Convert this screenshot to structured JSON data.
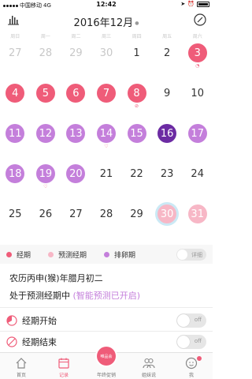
{
  "status_bar": {
    "carrier": "中国移动",
    "network": "4G",
    "time": "12:42"
  },
  "header": {
    "title": "2016年12月"
  },
  "weekdays": [
    "周日",
    "周一",
    "周二",
    "周三",
    "周四",
    "周五",
    "周六"
  ],
  "calendar": {
    "weeks": [
      [
        {
          "day": "27",
          "state": "prev"
        },
        {
          "day": "28",
          "state": "prev"
        },
        {
          "day": "29",
          "state": "prev"
        },
        {
          "day": "30",
          "state": "prev"
        },
        {
          "day": "1",
          "state": "normal"
        },
        {
          "day": "2",
          "state": "normal"
        },
        {
          "day": "3",
          "state": "period",
          "mark": "period-start"
        }
      ],
      [
        {
          "day": "4",
          "state": "period"
        },
        {
          "day": "5",
          "state": "period"
        },
        {
          "day": "6",
          "state": "period"
        },
        {
          "day": "7",
          "state": "period"
        },
        {
          "day": "8",
          "state": "period",
          "mark": "period-end"
        },
        {
          "day": "9",
          "state": "normal"
        },
        {
          "day": "10",
          "state": "normal"
        }
      ],
      [
        {
          "day": "11",
          "state": "ovulation"
        },
        {
          "day": "12",
          "state": "ovulation"
        },
        {
          "day": "13",
          "state": "ovulation"
        },
        {
          "day": "14",
          "state": "ovulation",
          "mark": "heart"
        },
        {
          "day": "15",
          "state": "ovulation"
        },
        {
          "day": "16",
          "state": "ovulation-day"
        },
        {
          "day": "17",
          "state": "ovulation"
        }
      ],
      [
        {
          "day": "18",
          "state": "ovulation"
        },
        {
          "day": "19",
          "state": "ovulation",
          "mark": "heart"
        },
        {
          "day": "20",
          "state": "ovulation"
        },
        {
          "day": "21",
          "state": "normal"
        },
        {
          "day": "22",
          "state": "normal"
        },
        {
          "day": "23",
          "state": "normal"
        },
        {
          "day": "24",
          "state": "normal"
        }
      ],
      [
        {
          "day": "25",
          "state": "normal"
        },
        {
          "day": "26",
          "state": "normal"
        },
        {
          "day": "27",
          "state": "normal"
        },
        {
          "day": "28",
          "state": "normal"
        },
        {
          "day": "29",
          "state": "normal"
        },
        {
          "day": "30",
          "state": "today-predicted"
        },
        {
          "day": "31",
          "state": "predicted"
        }
      ]
    ]
  },
  "legend": {
    "items": [
      {
        "label": "经期",
        "color": "#ef5c79"
      },
      {
        "label": "预测经期",
        "color": "#f7b7c6"
      },
      {
        "label": "排卵期",
        "color": "#c47fdb"
      }
    ],
    "detail_toggle": "详细"
  },
  "info": {
    "lunar_date": "农历丙申(猴)年腊月初二",
    "phase_text": "处于预测经期中",
    "phase_note": "(智能预测已开启)"
  },
  "settings": [
    {
      "label": "经期开始",
      "state": "off"
    },
    {
      "label": "经期结束",
      "state": "off"
    }
  ],
  "tabbar": {
    "tabs": [
      {
        "label": "首页",
        "icon": "home-icon",
        "active": false
      },
      {
        "label": "记录",
        "icon": "calendar-icon",
        "active": true
      },
      {
        "label": "年终促销",
        "icon": "promo-icon",
        "active": false,
        "center_text": "唯品会"
      },
      {
        "label": "姐妹说",
        "icon": "sisters-icon",
        "active": false
      },
      {
        "label": "我",
        "icon": "profile-icon",
        "active": false
      }
    ]
  }
}
